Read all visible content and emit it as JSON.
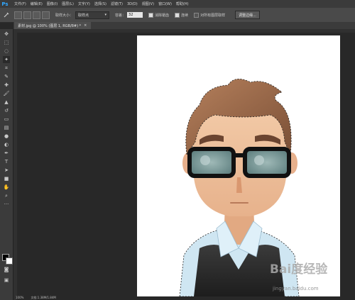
{
  "app": {
    "logo": "Ps"
  },
  "menu": [
    "文件(F)",
    "编辑(E)",
    "图像(I)",
    "图层(L)",
    "文字(Y)",
    "选择(S)",
    "滤镜(T)",
    "3D(D)",
    "视图(V)",
    "窗口(W)",
    "帮助(H)"
  ],
  "options": {
    "sample_size_label": "取样大小：",
    "sample_size_value": "取样点",
    "tolerance_label": "容差：",
    "tolerance_value": "32",
    "anti_alias": "消除锯齿",
    "contiguous": "连续",
    "sample_all_layers": "对所有图层取样",
    "refine_edge": "调整边缘..."
  },
  "document_tab": {
    "title": "素材.jpg @ 100% (图层 1, RGB/8#) *"
  },
  "status": {
    "zoom": "100%",
    "doc_info": "文档:1.38M/1.84M"
  },
  "colors": {
    "foreground": "#000000",
    "background": "#ffffff",
    "selection_border": "#222222"
  },
  "watermark": {
    "text": "Bai度经验",
    "url": "jingyan.baidu.com"
  },
  "tools": [
    "move-tool-icon",
    "marquee-tool-icon",
    "lasso-tool-icon",
    "magic-wand-tool-icon",
    "crop-tool-icon",
    "eyedropper-tool-icon",
    "healing-brush-icon",
    "brush-tool-icon",
    "clone-stamp-icon",
    "history-brush-icon",
    "eraser-tool-icon",
    "gradient-tool-icon",
    "blur-tool-icon",
    "dodge-tool-icon",
    "pen-tool-icon",
    "type-tool-icon",
    "path-selection-icon",
    "shape-tool-icon",
    "hand-tool-icon",
    "zoom-tool-icon"
  ]
}
